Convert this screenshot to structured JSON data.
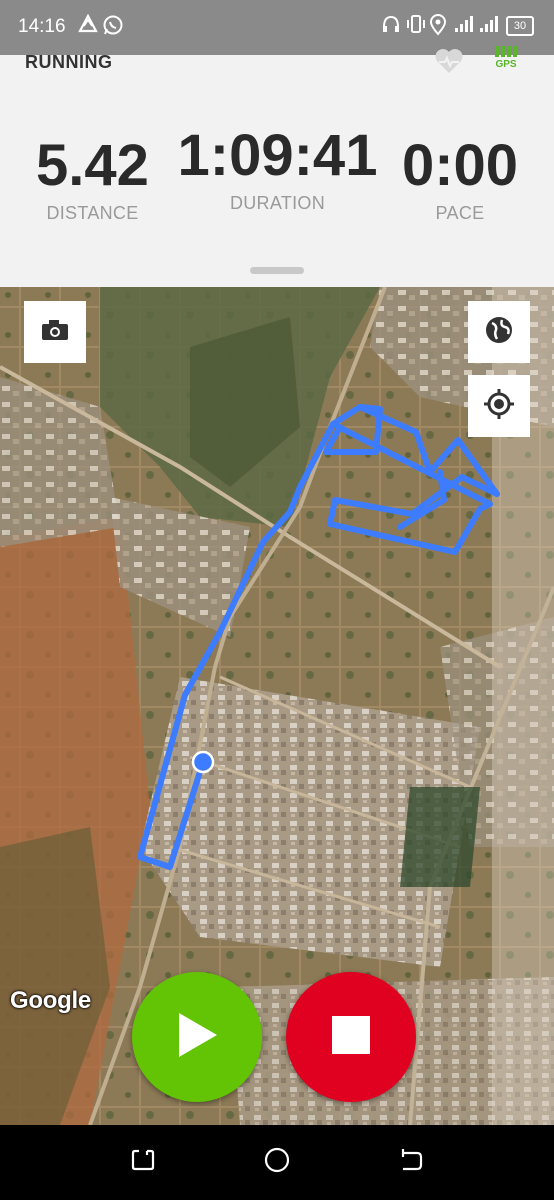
{
  "status_bar": {
    "time": "14:16",
    "battery": "30",
    "left_icons": [
      "triangle-app-icon",
      "whatsapp-icon"
    ],
    "right_icons": [
      "headset-icon",
      "vibrate-icon",
      "location-icon",
      "signal-icon",
      "signal-icon",
      "battery-icon"
    ]
  },
  "header": {
    "activity": "RUNNING",
    "heart_icon": "heart-icon",
    "gps_label": "GPS",
    "gps_color": "#5ab52a"
  },
  "stats": {
    "distance": {
      "value": "5.42",
      "label": "DISTANCE"
    },
    "duration": {
      "value": "1:09:41",
      "label": "DURATION"
    },
    "pace": {
      "value": "0:00",
      "label": "PACE"
    }
  },
  "map": {
    "attribution": "Google",
    "route_color": "#3d7bff",
    "buttons": [
      "camera-icon",
      "globe-icon",
      "crosshair-icon"
    ]
  },
  "controls": {
    "start_color": "#63c405",
    "stop_color": "#e0001f",
    "start_icon": "play-icon",
    "stop_icon": "stop-icon"
  },
  "nav_bar": {
    "icons": [
      "recent-apps-icon",
      "home-icon",
      "back-icon"
    ]
  }
}
